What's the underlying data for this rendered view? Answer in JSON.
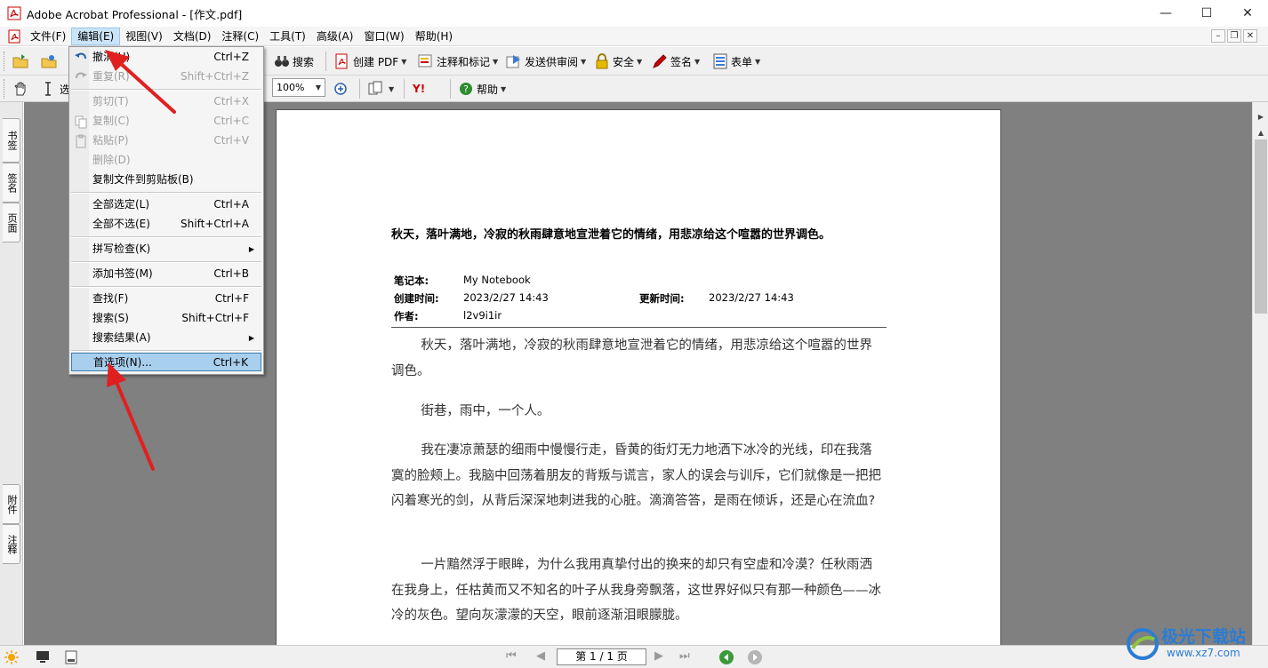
{
  "window": {
    "title": "Adobe Acrobat Professional - [作文.pdf]",
    "minimize": "—",
    "maximize": "☐",
    "close": "✕"
  },
  "menubar": {
    "items": [
      "文件(F)",
      "编辑(E)",
      "视图(V)",
      "文档(D)",
      "注释(C)",
      "工具(T)",
      "高级(A)",
      "窗口(W)",
      "帮助(H)"
    ],
    "active_index": 1,
    "mdi_minimize": "–",
    "mdi_restore": "❐",
    "mdi_close": "✕"
  },
  "toolbar": {
    "search": "搜索",
    "create_pdf": "创建 PDF",
    "comment_markup": "注释和标记",
    "send_review": "发送供审阅",
    "secure": "安全",
    "sign": "签名",
    "forms": "表单",
    "select_partial": "选",
    "zoom": "100%",
    "help": "帮助",
    "yahoo": "Y!"
  },
  "left_tabs": [
    "书签",
    "签名",
    "页面",
    "附件",
    "注释"
  ],
  "edit_menu": {
    "items": [
      {
        "label": "撤消(U)",
        "shortcut": "Ctrl+Z",
        "disabled": false
      },
      {
        "label": "重复(R)",
        "shortcut": "Shift+Ctrl+Z",
        "disabled": true
      },
      {
        "label": "剪切(T)",
        "shortcut": "Ctrl+X",
        "disabled": true
      },
      {
        "label": "复制(C)",
        "shortcut": "Ctrl+C",
        "disabled": true
      },
      {
        "label": "粘贴(P)",
        "shortcut": "Ctrl+V",
        "disabled": true
      },
      {
        "label": "删除(D)",
        "shortcut": "",
        "disabled": true
      },
      {
        "label": "复制文件到剪贴板(B)",
        "shortcut": "",
        "disabled": false
      },
      {
        "label": "全部选定(L)",
        "shortcut": "Ctrl+A",
        "disabled": false
      },
      {
        "label": "全部不选(E)",
        "shortcut": "Shift+Ctrl+A",
        "disabled": false
      },
      {
        "label": "拼写检查(K)",
        "shortcut": "",
        "disabled": false,
        "submenu": true
      },
      {
        "label": "添加书签(M)",
        "shortcut": "Ctrl+B",
        "disabled": false
      },
      {
        "label": "查找(F)",
        "shortcut": "Ctrl+F",
        "disabled": false
      },
      {
        "label": "搜索(S)",
        "shortcut": "Shift+Ctrl+F",
        "disabled": false
      },
      {
        "label": "搜索结果(A)",
        "shortcut": "",
        "disabled": false,
        "submenu": true
      },
      {
        "label": "首选项(N)...",
        "shortcut": "Ctrl+K",
        "disabled": false,
        "highlighted": true
      }
    ]
  },
  "document": {
    "heading": "秋天，落叶满地，冷寂的秋雨肆意地宣泄着它的情绪，用悲凉给这个喧嚣的世界调色。",
    "notebook_label": "笔记本:",
    "notebook_value": "My Notebook",
    "created_label": "创建时间:",
    "created_value": "2023/2/27 14:43",
    "updated_label": "更新时间:",
    "updated_value": "2023/2/27 14:43",
    "author_label": "作者:",
    "author_value": "l2v9i1ir",
    "paragraphs": [
      "秋天，落叶满地，冷寂的秋雨肆意地宣泄着它的情绪，用悲凉给这个喧嚣的世界调色。",
      "街巷，雨中，一个人。",
      "我在凄凉萧瑟的细雨中慢慢行走，昏黄的街灯无力地洒下冰冷的光线，印在我落寞的脸颊上。我脑中回荡着朋友的背叛与谎言，家人的误会与训斥，它们就像是一把把闪着寒光的剑，从背后深深地刺进我的心脏。滴滴答答，是雨在倾诉，还是心在流血?",
      "一片黯然浮于眼眸，为什么我用真挚付出的换来的却只有空虚和冷漠？任秋雨洒在我身上，任枯黄而又不知名的叶子从我身旁飘落，这世界好似只有那一种颜色——冰冷的灰色。望向灰濛濛的天空，眼前逐渐泪眼朦胧。"
    ]
  },
  "statusbar": {
    "page_indicator": "第 1 / 1 页"
  },
  "watermark": {
    "brand": "极光下载站",
    "url": "www.xz7.com"
  }
}
